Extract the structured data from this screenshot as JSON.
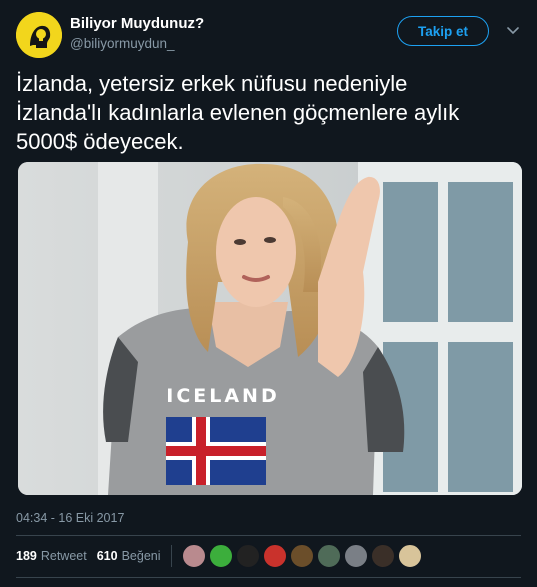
{
  "author": {
    "name": "Biliyor Muydunuz?",
    "handle": "@biliyormuydun_"
  },
  "follow_button": {
    "label": "Takip et"
  },
  "tweet": {
    "lines": [
      "İzlanda, yetersiz erkek nüfusu nedeniyle",
      "İzlanda'lı kadınlarla evlenen göçmenlere aylık",
      "5000$ ödeyecek."
    ]
  },
  "photo": {
    "shirt_text": "ICELAND"
  },
  "timestamp": "04:34 - 16 Eki 2017",
  "stats": {
    "retweets": "189",
    "retweets_label": "Retweet",
    "likes": "610",
    "likes_label": "Beğeni"
  },
  "likers": [
    {
      "color": "#b98a8e"
    },
    {
      "color": "#3cae3c"
    },
    {
      "color": "#222222"
    },
    {
      "color": "#c9322c"
    },
    {
      "color": "#6b4e2a"
    },
    {
      "color": "#4f6b58"
    },
    {
      "color": "#7a7f86"
    },
    {
      "color": "#3a2f28"
    },
    {
      "color": "#d8c49a"
    }
  ],
  "colors": {
    "background": "#10171e",
    "accent": "#1da1f2",
    "muted": "#8899a6"
  }
}
